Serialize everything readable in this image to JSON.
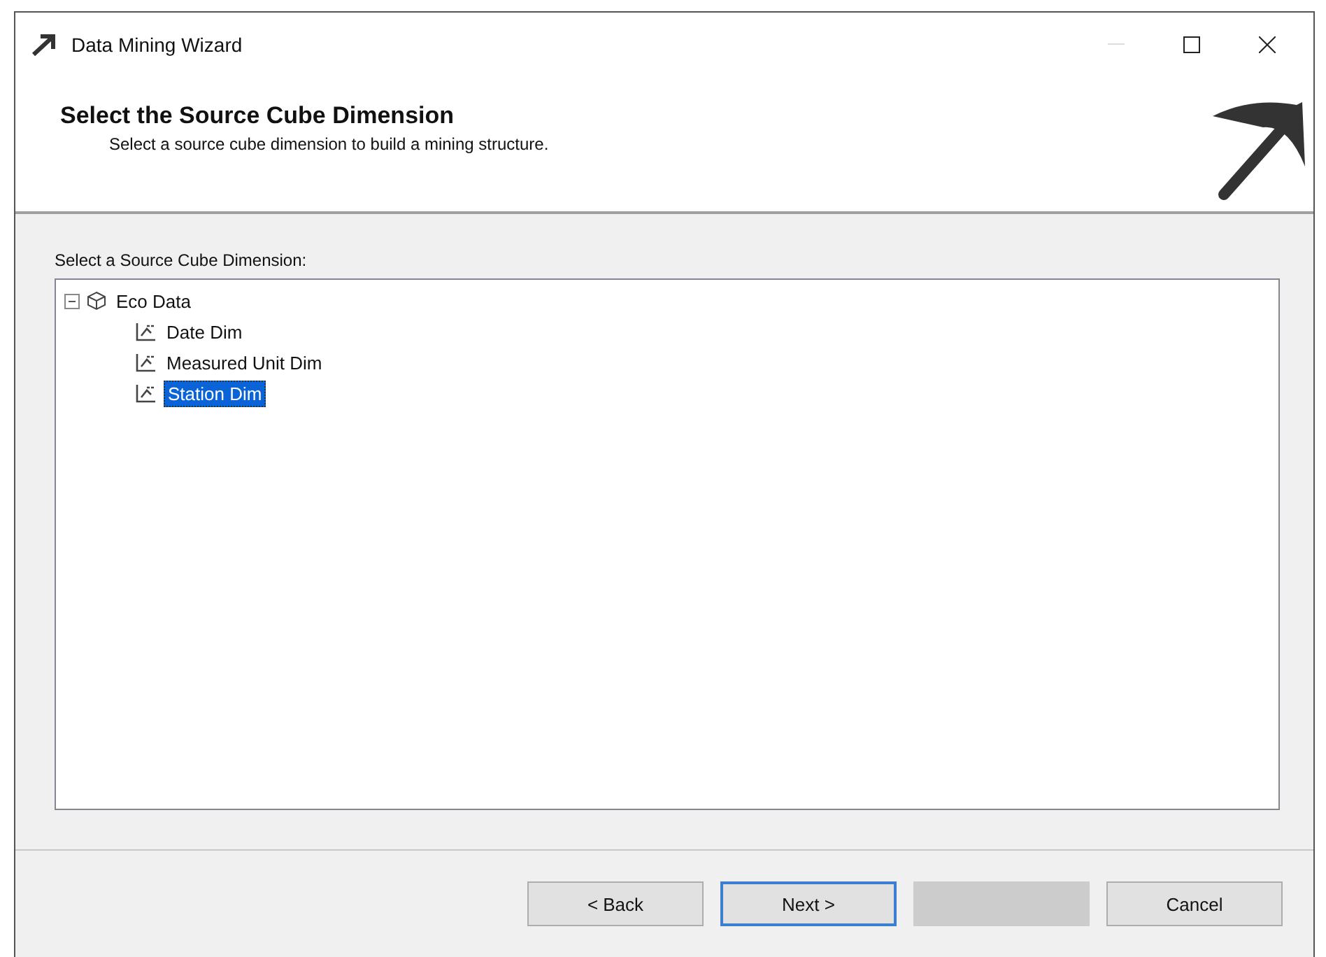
{
  "window": {
    "title": "Data Mining Wizard"
  },
  "header": {
    "title": "Select the Source Cube Dimension",
    "subtitle": "Select a source cube dimension to build a mining structure."
  },
  "tree": {
    "label": "Select a Source Cube Dimension:",
    "items": [
      {
        "label": "Eco Data",
        "kind": "cube",
        "expanded": true,
        "selected": false,
        "children": [
          {
            "label": "Date Dim",
            "kind": "dimension",
            "selected": false
          },
          {
            "label": "Measured Unit Dim",
            "kind": "dimension",
            "selected": false
          },
          {
            "label": "Station Dim",
            "kind": "dimension",
            "selected": true
          }
        ]
      }
    ]
  },
  "buttons": [
    {
      "label": "< Back",
      "disabled": false,
      "default": false
    },
    {
      "label": "Next >",
      "disabled": false,
      "default": true
    },
    {
      "disabled": true,
      "default": false
    },
    {
      "label": "Cancel",
      "disabled": false,
      "default": false
    }
  ]
}
